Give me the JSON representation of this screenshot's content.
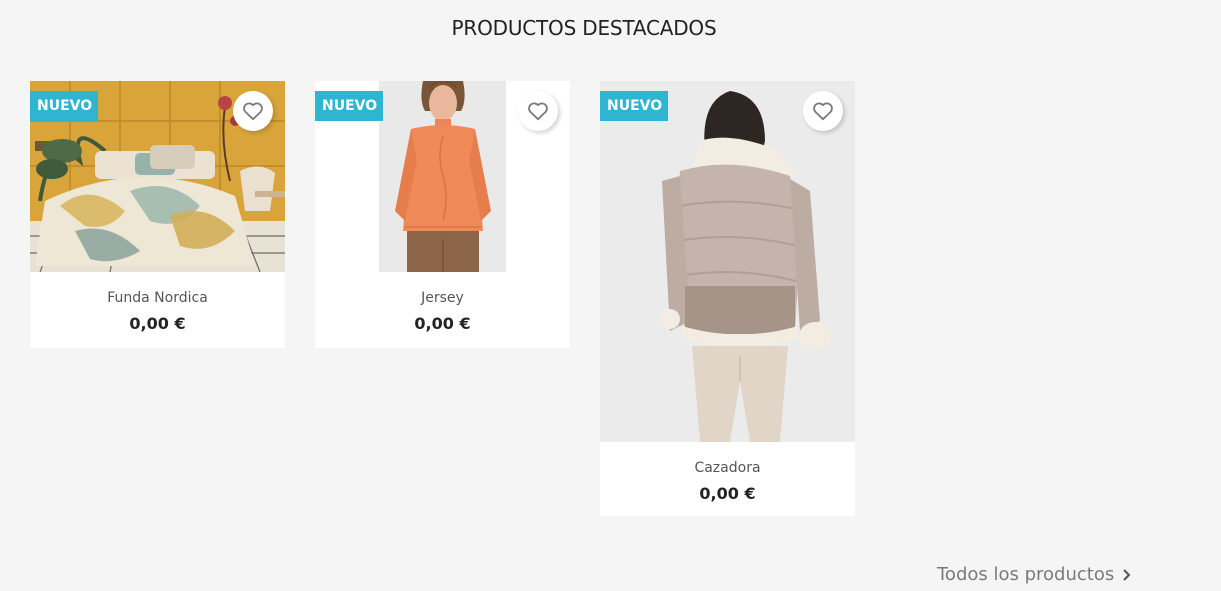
{
  "section": {
    "title": "PRODUCTOS DESTACADOS"
  },
  "products": [
    {
      "badge": "NUEVO",
      "name": "Funda Nordica",
      "price": "0,00 €",
      "image_alt": "bedroom-duvet-photo"
    },
    {
      "badge": "NUEVO",
      "name": "Jersey",
      "price": "0,00 €",
      "image_alt": "orange-sweater-photo"
    },
    {
      "badge": "NUEVO",
      "name": "Cazadora",
      "price": "0,00 €",
      "image_alt": "puffer-jacket-photo"
    }
  ],
  "footer": {
    "all_products_label": "Todos los productos"
  },
  "colors": {
    "badge": "#2fb5d2",
    "background": "#f5f5f5",
    "card": "#ffffff"
  },
  "icons": {
    "wishlist": "heart-outline-icon",
    "link_arrow": "chevron-right-icon"
  }
}
